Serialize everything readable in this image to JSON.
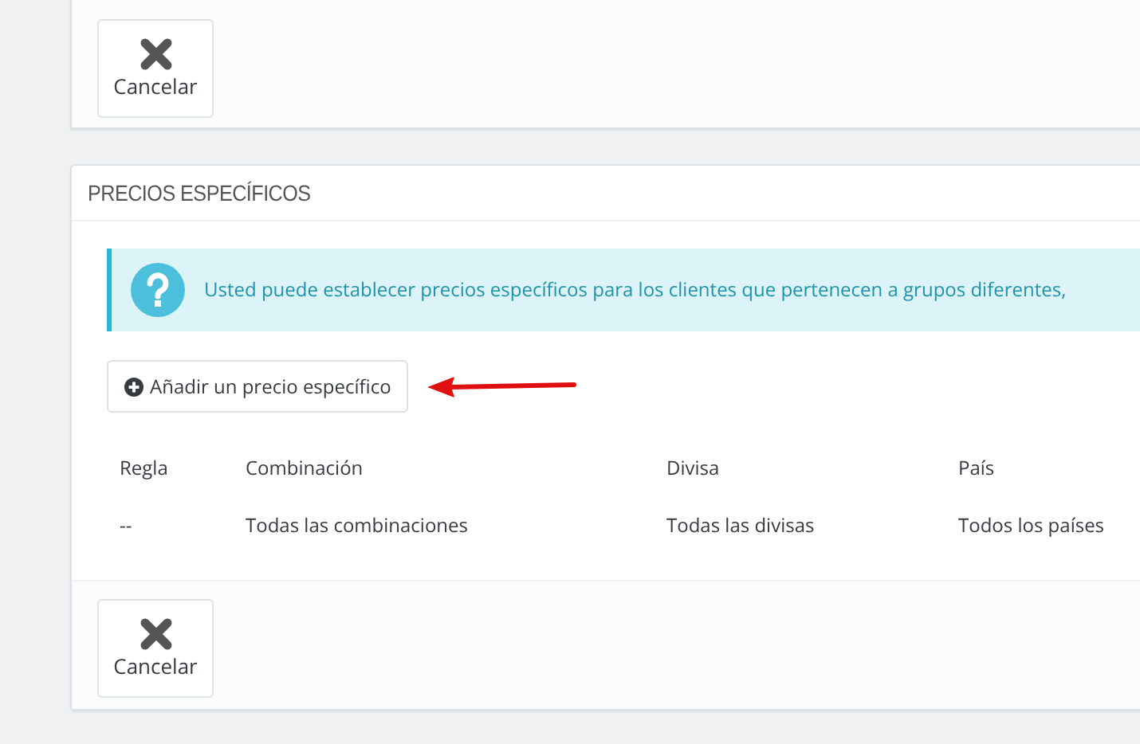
{
  "top_footer": {
    "cancel_button": "Cancelar"
  },
  "panel": {
    "title": "PRECIOS ESPECÍFICOS",
    "info": "Usted puede establecer precios específicos para los clientes que pertenecen a grupos diferentes,",
    "add_button": "Añadir un precio específico",
    "table": {
      "columns": [
        "Regla",
        "Combinación",
        "Divisa",
        "País"
      ],
      "rows": [
        [
          "--",
          "Todas las combinaciones",
          "Todas las divisas",
          "Todos los países"
        ]
      ]
    },
    "cancel_button": "Cancelar"
  }
}
